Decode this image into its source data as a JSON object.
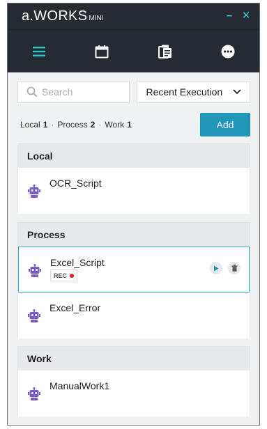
{
  "app": {
    "logo_main": "a.WORKS",
    "logo_sub": "MINI"
  },
  "window_controls": {
    "minimize": "–",
    "close": "✕"
  },
  "nav": {
    "tabs": [
      {
        "name": "menu-icon"
      },
      {
        "name": "calendar-icon"
      },
      {
        "name": "clipboard-icon"
      },
      {
        "name": "more-icon"
      }
    ]
  },
  "search": {
    "placeholder": "Search",
    "value": ""
  },
  "filter": {
    "selected": "Recent Execution"
  },
  "counts": {
    "local_label": "Local",
    "local_count": "1",
    "process_label": "Process",
    "process_count": "2",
    "work_label": "Work",
    "work_count": "1",
    "separator": "·"
  },
  "add_button": "Add",
  "sections": {
    "local": {
      "title": "Local",
      "items": [
        {
          "name": "OCR_Script"
        }
      ]
    },
    "process": {
      "title": "Process",
      "items": [
        {
          "name": "Excel_Script",
          "badge": "REC"
        },
        {
          "name": "Excel_Error"
        }
      ]
    },
    "work": {
      "title": "Work",
      "items": [
        {
          "name": "ManualWork1"
        }
      ]
    }
  },
  "colors": {
    "titlebar": "#262a31",
    "accent": "#2ec7cf",
    "add_button": "#2196b8",
    "robot_icon": "#7b5cc4",
    "rec_dot": "#e02424"
  }
}
